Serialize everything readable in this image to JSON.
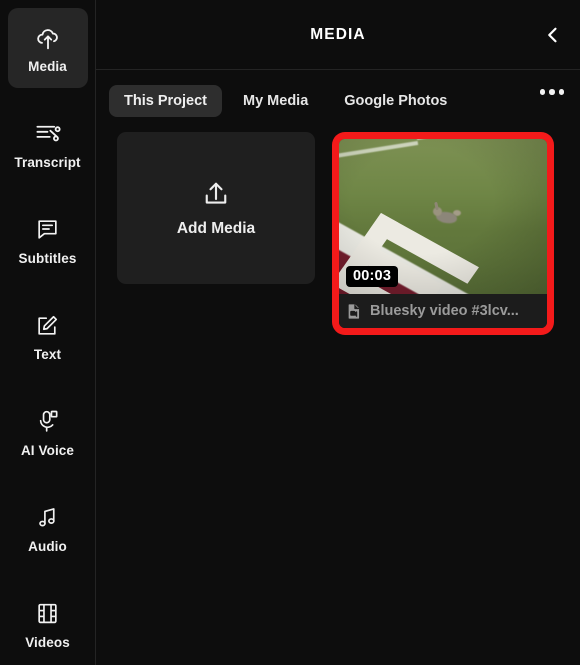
{
  "app": {
    "background_color": "#0d0d0d",
    "accent_color": "#f31a1a"
  },
  "sidebar": {
    "items": [
      {
        "label": "Media",
        "icon": "cloud-upload-icon",
        "active": true
      },
      {
        "label": "Transcript",
        "icon": "transcript-icon",
        "active": false
      },
      {
        "label": "Subtitles",
        "icon": "subtitles-icon",
        "active": false
      },
      {
        "label": "Text",
        "icon": "text-edit-icon",
        "active": false
      },
      {
        "label": "AI Voice",
        "icon": "microphone-ai-icon",
        "active": false
      },
      {
        "label": "Audio",
        "icon": "music-note-icon",
        "active": false
      },
      {
        "label": "Videos",
        "icon": "film-strip-icon",
        "active": false
      }
    ]
  },
  "header": {
    "title": "MEDIA",
    "collapse_icon": "chevron-left-icon"
  },
  "tabs": {
    "items": [
      {
        "label": "This Project",
        "active": true
      },
      {
        "label": "My Media",
        "active": false
      },
      {
        "label": "Google Photos",
        "active": false
      }
    ],
    "overflow_icon": "more-horizontal-icon"
  },
  "media": {
    "add_media": {
      "label": "Add Media",
      "icon": "upload-icon"
    },
    "items": [
      {
        "name": "Bluesky video #3lcv...",
        "duration": "00:03",
        "file_icon": "video-file-icon",
        "selected": true,
        "selection_color": "#f31a1a"
      }
    ]
  }
}
